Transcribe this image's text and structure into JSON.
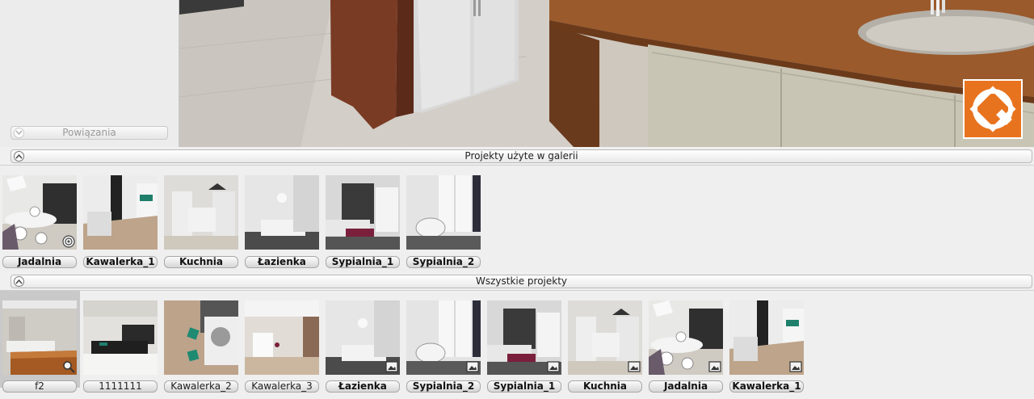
{
  "left_panel": {
    "link_label": "Powiązania"
  },
  "gallery_section": {
    "title": "Projekty użyte w galerii",
    "items": [
      {
        "label": "Jadalnia",
        "scene": "dining",
        "badge": "target-icon"
      },
      {
        "label": "Kawalerka_1",
        "scene": "studio"
      },
      {
        "label": "Kuchnia",
        "scene": "kitchen"
      },
      {
        "label": "Łazienka",
        "scene": "bath"
      },
      {
        "label": "Sypialnia_1",
        "scene": "bed1"
      },
      {
        "label": "Sypialnia_2",
        "scene": "bed2"
      }
    ]
  },
  "all_section": {
    "title": "Wszystkie projekty",
    "items": [
      {
        "label": "f2",
        "scene": "kitchen2",
        "badge": "zoom-icon",
        "bold": false,
        "selected": true
      },
      {
        "label": "1111111",
        "scene": "kitchen3",
        "bold": false
      },
      {
        "label": "Kawalerka_2",
        "scene": "topview",
        "bold": false
      },
      {
        "label": "Kawalerka_3",
        "scene": "brick",
        "bold": false
      },
      {
        "label": "Łazienka",
        "scene": "bath",
        "badge": "image-icon",
        "bold": true
      },
      {
        "label": "Sypialnia_2",
        "scene": "bed2",
        "badge": "image-icon",
        "bold": true
      },
      {
        "label": "Sypialnia_1",
        "scene": "bed1",
        "badge": "image-icon",
        "bold": true
      },
      {
        "label": "Kuchnia",
        "scene": "kitchen",
        "badge": "image-icon",
        "bold": true
      },
      {
        "label": "Jadalnia",
        "scene": "dining",
        "badge": "image-icon",
        "bold": true
      },
      {
        "label": "Kawalerka_1",
        "scene": "studio",
        "badge": "image-icon",
        "bold": true
      }
    ]
  },
  "colors": {
    "logo_orange": "#e8731e",
    "wood": "#8a4a22",
    "counter": "#c9c5b4"
  }
}
